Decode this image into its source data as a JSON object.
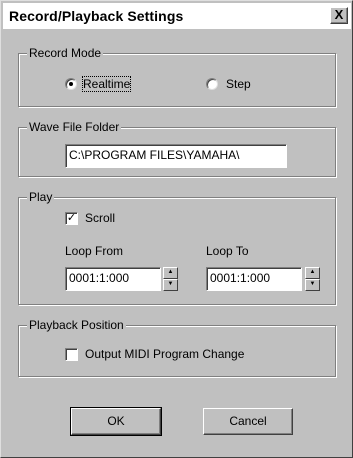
{
  "window": {
    "title": "Record/Playback Settings",
    "close_glyph": "X"
  },
  "record_mode": {
    "legend": "Record Mode",
    "options": [
      {
        "label": "Realtime",
        "selected": true
      },
      {
        "label": "Step",
        "selected": false
      }
    ]
  },
  "wave_folder": {
    "legend": "Wave File Folder",
    "value": "C:\\PROGRAM FILES\\YAMAHA\\"
  },
  "play": {
    "legend": "Play",
    "scroll_label": "Scroll",
    "scroll_checked": true,
    "check_glyph": "✓",
    "loop_from_label": "Loop From",
    "loop_from_value": "0001:1:000",
    "loop_to_label": "Loop To",
    "loop_to_value": "0001:1:000",
    "spin_up_glyph": "▲",
    "spin_down_glyph": "▼"
  },
  "playback_position": {
    "legend": "Playback Position",
    "midi_label": "Output MIDI Program Change",
    "midi_checked": false
  },
  "buttons": {
    "ok": "OK",
    "cancel": "Cancel"
  }
}
